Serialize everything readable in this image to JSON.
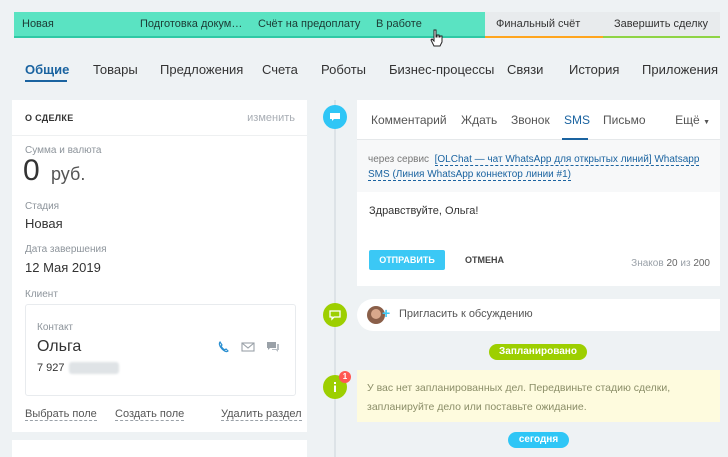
{
  "stages": [
    {
      "label": "Новая",
      "state": "active"
    },
    {
      "label": "Подготовка документов",
      "state": "active"
    },
    {
      "label": "Счёт на предоплату",
      "state": "active"
    },
    {
      "label": "В работе",
      "state": "active"
    },
    {
      "label": "Финальный счёт",
      "state": "inactive"
    },
    {
      "label": "Завершить сделку",
      "state": "last"
    }
  ],
  "tabs": [
    "Общие",
    "Товары",
    "Предложения",
    "Счета",
    "Роботы",
    "Бизнес-процессы",
    "Связи",
    "История",
    "Приложения"
  ],
  "deal": {
    "title": "О СДЕЛКЕ",
    "edit": "изменить",
    "amount_label": "Сумма и валюта",
    "amount": "0",
    "currency": "руб.",
    "stage_label": "Стадия",
    "stage": "Новая",
    "close_label": "Дата завершения",
    "close_date": "12 Мая 2019",
    "client_label": "Клиент",
    "contact_label": "Контакт",
    "contact_name": "Ольга",
    "contact_phone": "7 927",
    "links": {
      "select": "Выбрать поле",
      "create": "Создать поле",
      "delete": "Удалить раздел"
    }
  },
  "composer": {
    "tabs": [
      "Комментарий",
      "Ждать",
      "Звонок",
      "SMS",
      "Письмо"
    ],
    "more": "Ещё",
    "via_prefix": "через сервис",
    "via_link": "[OLChat — чат WhatsApp для открытых линий] Whatsapp SMS (Линия WhatsApp коннектор линии #1)",
    "message": "Здравствуйте, Ольга!",
    "send": "ОТПРАВИТЬ",
    "cancel": "ОТМЕНА",
    "counter_prefix": "Знаков",
    "counter_value": "20",
    "counter_of": "из",
    "counter_max": "200"
  },
  "invite": "Пригласить к обсуждению",
  "planned_pill": "Запланировано",
  "notice": {
    "badge": "1",
    "text": "У вас нет запланированных дел. Передвиньте стадию сделки, запланируйте дело или поставьте ожидание."
  },
  "today_pill": "сегодня",
  "colors": {
    "stage_active": "#5ae3c2",
    "accent_blue": "#1a63a0",
    "send_button": "#3bc8f5",
    "planned_green": "#9dcf00",
    "today_blue": "#2fc6f6"
  },
  "icons": [
    "phone-icon",
    "mail-icon",
    "chat-icon",
    "comment-icon",
    "info-icon",
    "hand-cursor-icon"
  ]
}
